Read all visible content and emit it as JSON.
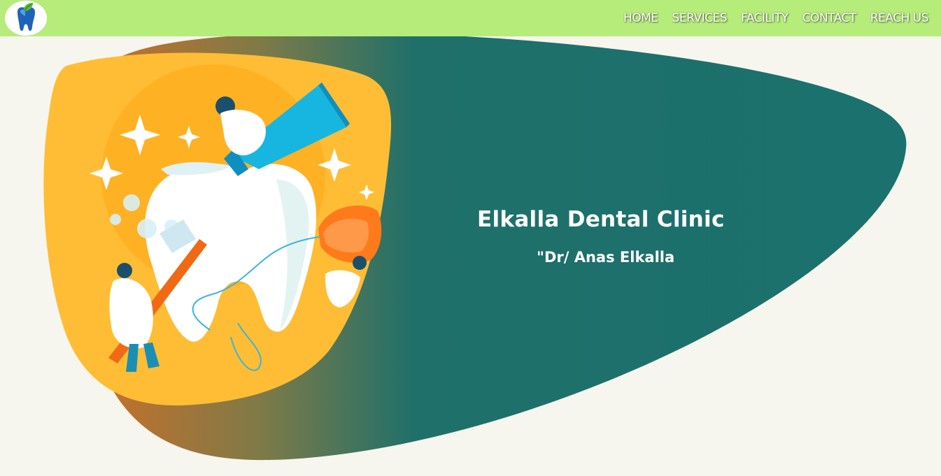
{
  "nav": {
    "logo_icon": "tooth-leaf-logo-icon",
    "links": [
      {
        "label": "HOME"
      },
      {
        "label": "SERVICES"
      },
      {
        "label": "FACILITY"
      },
      {
        "label": "CONTACT"
      },
      {
        "label": "REACH US"
      }
    ]
  },
  "hero": {
    "title": "Elkalla Dental Clinic",
    "subtitle": "\"Dr/ Anas Elkalla",
    "illustration_icon": "dentists-cleaning-tooth-illustration",
    "colors": {
      "navbar": "#b6ec7a",
      "background": "#f6f5ee",
      "blob_teal": "#1a716e",
      "blob_orange": "#c8702a",
      "illustration_yellow": "#ffbd35"
    }
  }
}
